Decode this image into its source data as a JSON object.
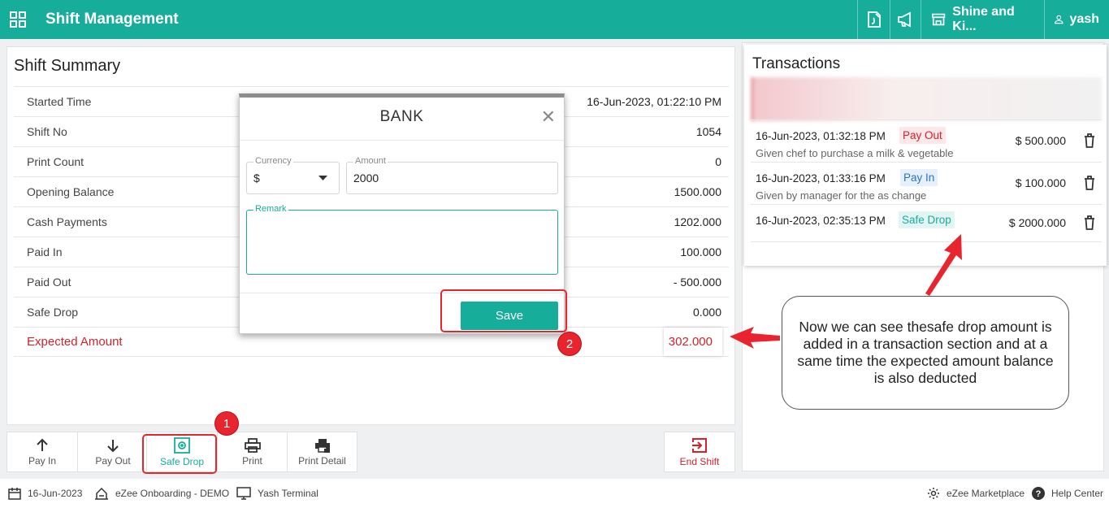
{
  "header": {
    "title": "Shift Management",
    "property_name": "Shine and Ki...",
    "user_name": "yash",
    "brand_color": "#17ad9b"
  },
  "summary": {
    "title": "Shift Summary",
    "rows": [
      {
        "label": "Started Time",
        "value": "16-Jun-2023, 01:22:10 PM"
      },
      {
        "label": "Shift No",
        "value": "1054"
      },
      {
        "label": "Print Count",
        "value": "0"
      },
      {
        "label": "Opening Balance",
        "value": "1500.000"
      },
      {
        "label": "Cash Payments",
        "value": "1202.000"
      },
      {
        "label": "Paid In",
        "value": "100.000"
      },
      {
        "label": "Paid Out",
        "value": "- 500.000"
      },
      {
        "label": "Safe Drop",
        "value": "0.000"
      }
    ],
    "expected_label": "Expected Amount",
    "expected_value": "302.000",
    "expected_color": "#d0232b"
  },
  "toolbar": {
    "pay_in": "Pay In",
    "pay_out": "Pay Out",
    "safe_drop": "Safe Drop",
    "print": "Print",
    "print_detail": "Print Detail",
    "end_shift": "End Shift"
  },
  "transactions": {
    "title": "Transactions",
    "items": [
      {
        "datetime": "16-Jun-2023, 01:32:18 PM",
        "type": "Pay Out",
        "description": "Given chef to purchase a milk & vegetable",
        "amount": "$ 500.000"
      },
      {
        "datetime": "16-Jun-2023, 01:33:16 PM",
        "type": "Pay In",
        "description": "Given by manager for the as change",
        "amount": "$ 100.000"
      },
      {
        "datetime": "16-Jun-2023, 02:35:13 PM",
        "type": "Safe Drop",
        "description": "",
        "amount": "$ 2000.000"
      }
    ]
  },
  "modal": {
    "title": "BANK",
    "currency_label": "Currency",
    "currency_value": "$",
    "amount_label": "Amount",
    "amount_value": "2000",
    "remark_label": "Remark",
    "remark_value": "",
    "save_label": "Save"
  },
  "annotations": {
    "step1": "1",
    "step2": "2",
    "callout": "Now we can see thesafe drop amount is added in a transaction section and at a same time the expected amount balance is also deducted"
  },
  "footer": {
    "date": "16-Jun-2023",
    "property": "eZee Onboarding - DEMO",
    "terminal": "Yash Terminal",
    "marketplace": "eZee Marketplace",
    "help": "Help Center"
  }
}
